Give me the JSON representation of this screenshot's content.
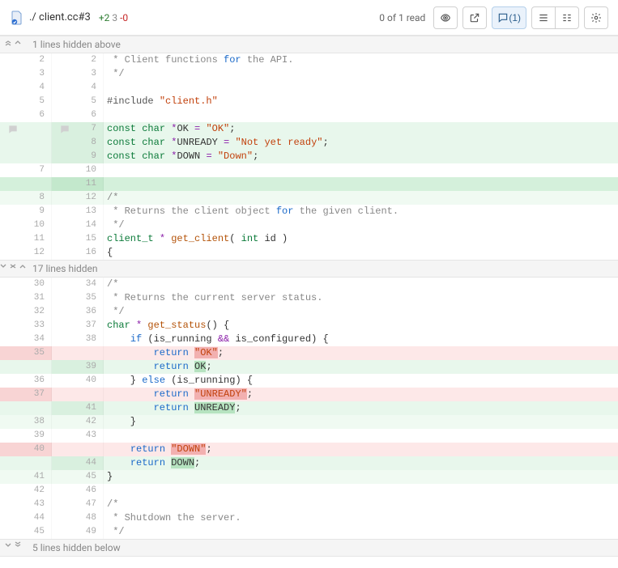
{
  "header": {
    "filename": "./ client.cc#3",
    "additions": "+2",
    "modifications": "3",
    "deletions": "-0",
    "read_status": "0 of 1 read",
    "comment_count": "(1)"
  },
  "folds": {
    "top": "1 lines hidden above",
    "mid": "17 lines hidden",
    "bottom": "5 lines hidden below"
  },
  "block1": [
    {
      "o": "2",
      "n": "2",
      "t": "context",
      "html": " <span class='cm'>* Client functions <span class='kw-blue'>for</span> the API.</span>"
    },
    {
      "o": "3",
      "n": "3",
      "t": "context",
      "html": " <span class='cm'>*/</span>"
    },
    {
      "o": "4",
      "n": "4",
      "t": "context",
      "html": ""
    },
    {
      "o": "5",
      "n": "5",
      "t": "context",
      "html": "<span class='pp'>#include</span> <span class='str'>\"client.h\"</span>"
    },
    {
      "o": "6",
      "n": "6",
      "t": "context",
      "html": ""
    },
    {
      "o": "",
      "n": "7",
      "t": "add",
      "comment": true,
      "html": "<span class='kw'>const</span> <span class='kw'>char</span> <span class='pn'>*</span>OK <span class='pn'>=</span> <span class='str'>\"OK\"</span>;"
    },
    {
      "o": "",
      "n": "8",
      "t": "add",
      "html": "<span class='kw'>const</span> <span class='kw'>char</span> <span class='pn'>*</span>UNREADY <span class='pn'>=</span> <span class='str'>\"Not yet ready\"</span>;"
    },
    {
      "o": "",
      "n": "9",
      "t": "add",
      "html": "<span class='kw'>const</span> <span class='kw'>char</span> <span class='pn'>*</span>DOWN <span class='pn'>=</span> <span class='str'>\"Down\"</span>;"
    },
    {
      "o": "7",
      "n": "10",
      "t": "context",
      "html": ""
    },
    {
      "o": "",
      "n": "11",
      "t": "add-strong",
      "html": ""
    },
    {
      "o": "8",
      "n": "12",
      "t": "faint-add",
      "html": "<span class='cm'>/*</span>"
    },
    {
      "o": "9",
      "n": "13",
      "t": "context",
      "html": " <span class='cm'>* Returns the client object <span class='kw-blue'>for</span> the given client.</span>"
    },
    {
      "o": "10",
      "n": "14",
      "t": "context",
      "html": " <span class='cm'>*/</span>"
    },
    {
      "o": "11",
      "n": "15",
      "t": "context",
      "html": "<span class='ty'>client_t</span> <span class='pn'>*</span> <span class='fn'>get_client</span>( <span class='kw'>int</span> id )"
    },
    {
      "o": "12",
      "n": "16",
      "t": "context",
      "html": "{"
    }
  ],
  "block2": [
    {
      "o": "30",
      "n": "34",
      "t": "context",
      "html": "<span class='cm'>/*</span>"
    },
    {
      "o": "31",
      "n": "35",
      "t": "context",
      "html": " <span class='cm'>* Returns the current server status.</span>"
    },
    {
      "o": "32",
      "n": "36",
      "t": "context",
      "html": " <span class='cm'>*/</span>"
    },
    {
      "o": "33",
      "n": "37",
      "t": "context",
      "html": "<span class='kw'>char</span> <span class='pn'>*</span> <span class='fn'>get_status</span>() {"
    },
    {
      "o": "34",
      "n": "38",
      "t": "context",
      "html": "    <span class='kw-blue'>if</span> (is_running <span class='pn'>&amp;&amp;</span> is_configured) {"
    },
    {
      "o": "35",
      "n": "",
      "t": "del",
      "html": "        <span class='kw-blue'>return</span> <span class='str hl-del'>\"OK\"</span>;"
    },
    {
      "o": "",
      "n": "39",
      "t": "add",
      "html": "        <span class='kw-blue'>return</span> <span class='hl-add'>OK</span>;"
    },
    {
      "o": "36",
      "n": "40",
      "t": "context",
      "html": "    } <span class='kw-blue'>else</span> (is_running) {"
    },
    {
      "o": "37",
      "n": "",
      "t": "del",
      "html": "        <span class='kw-blue'>return</span> <span class='str hl-del'>\"UNREADY\"</span>;"
    },
    {
      "o": "",
      "n": "41",
      "t": "add",
      "html": "        <span class='kw-blue'>return</span> <span class='hl-add'>UNREADY</span>;"
    },
    {
      "o": "38",
      "n": "42",
      "t": "faint-add",
      "html": "    }"
    },
    {
      "o": "39",
      "n": "43",
      "t": "context",
      "html": ""
    },
    {
      "o": "40",
      "n": "",
      "t": "del",
      "html": "    <span class='kw-blue'>return</span> <span class='str hl-del'>\"DOWN\"</span>;"
    },
    {
      "o": "",
      "n": "44",
      "t": "add",
      "html": "    <span class='kw-blue'>return</span> <span class='hl-add'>DOWN</span>;"
    },
    {
      "o": "41",
      "n": "45",
      "t": "faint-add",
      "html": "}"
    },
    {
      "o": "42",
      "n": "46",
      "t": "context",
      "html": ""
    },
    {
      "o": "43",
      "n": "47",
      "t": "context",
      "html": "<span class='cm'>/*</span>"
    },
    {
      "o": "44",
      "n": "48",
      "t": "context",
      "html": " <span class='cm'>* Shutdown the server.</span>"
    },
    {
      "o": "45",
      "n": "49",
      "t": "context",
      "html": " <span class='cm'>*/</span>"
    }
  ]
}
